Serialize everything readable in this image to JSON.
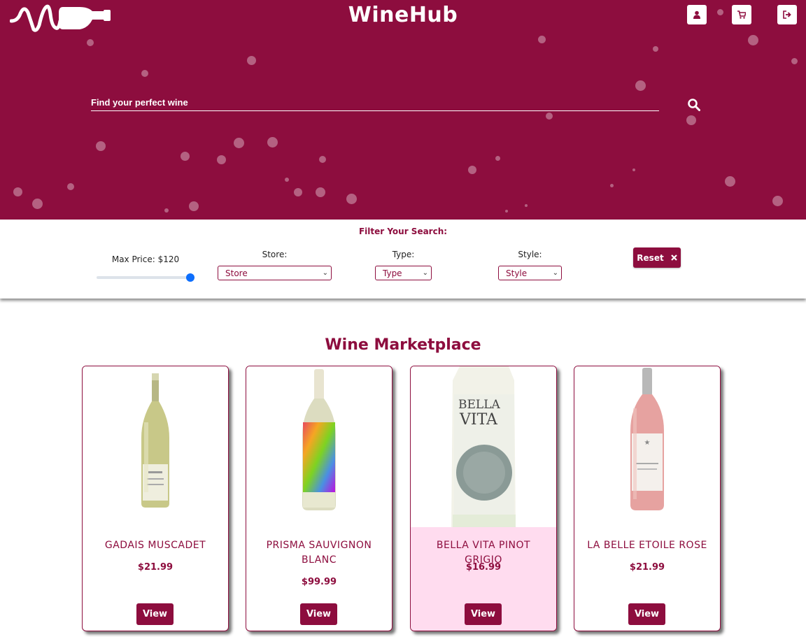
{
  "header": {
    "brand": "WineHub",
    "icons": [
      "user-icon",
      "cart-icon",
      "logout-icon"
    ]
  },
  "search": {
    "placeholder": "Find your perfect wine",
    "icon": "search-icon"
  },
  "filters": {
    "title": "Filter Your Search:",
    "max_price_label": "Max Price: $120",
    "max_price_value": 120,
    "store_label": "Store:",
    "store_value": "Store",
    "type_label": "Type:",
    "type_value": "Type",
    "style_label": "Style:",
    "style_value": "Style",
    "reset_label": "Reset"
  },
  "marketplace": {
    "title": "Wine Marketplace",
    "view_label": "View",
    "cards": [
      {
        "name": "GADAIS MUSCADET",
        "price": "$21.99",
        "bottle_color": "#c8c888",
        "label_color": "#efeede"
      },
      {
        "name": "PRISMA SAUVIGNON BLANC",
        "price": "$99.99",
        "bottle_color": "#dcdcc0",
        "label_color": "#e080c8"
      },
      {
        "name": "BELLA VITA PINOT GRIGIO",
        "price": "$16.99",
        "bottle_color": "#f2f2e8",
        "label_color": "#8a9a96"
      },
      {
        "name": "LA BELLE ETOILE ROSE",
        "price": "$21.99",
        "bottle_color": "#e6a2a0",
        "label_color": "#f4f0ec"
      }
    ]
  },
  "colors": {
    "brand": "#8d0d3e",
    "highlight_card": "#ffdcef",
    "slider_thumb": "#0d6efd"
  }
}
